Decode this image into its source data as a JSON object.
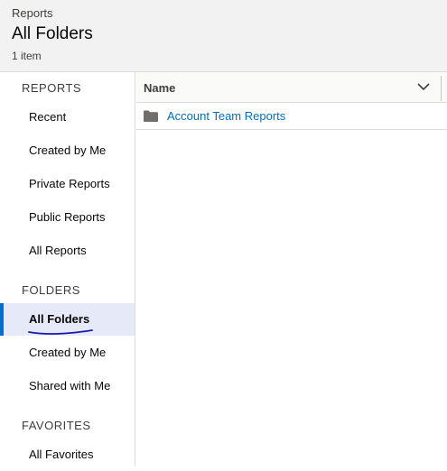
{
  "header": {
    "breadcrumb": "Reports",
    "title": "All Folders",
    "item_count": "1 item"
  },
  "sidebar": {
    "reports_heading": "REPORTS",
    "reports_items": [
      {
        "label": "Recent"
      },
      {
        "label": "Created by Me"
      },
      {
        "label": "Private Reports"
      },
      {
        "label": "Public Reports"
      },
      {
        "label": "All Reports"
      }
    ],
    "folders_heading": "FOLDERS",
    "folders_items": [
      {
        "label": "All Folders",
        "active": true
      },
      {
        "label": "Created by Me"
      },
      {
        "label": "Shared with Me"
      }
    ],
    "favorites_heading": "FAVORITES",
    "favorites_items": [
      {
        "label": "All Favorites"
      }
    ]
  },
  "table": {
    "column_name": "Name",
    "rows": [
      {
        "name": "Account Team Reports",
        "icon": "folder-icon"
      }
    ]
  },
  "colors": {
    "accent": "#0070d2",
    "link": "#006dcc",
    "active_bg": "#e6e9f7",
    "annotation_ink": "#1a1aa8"
  }
}
